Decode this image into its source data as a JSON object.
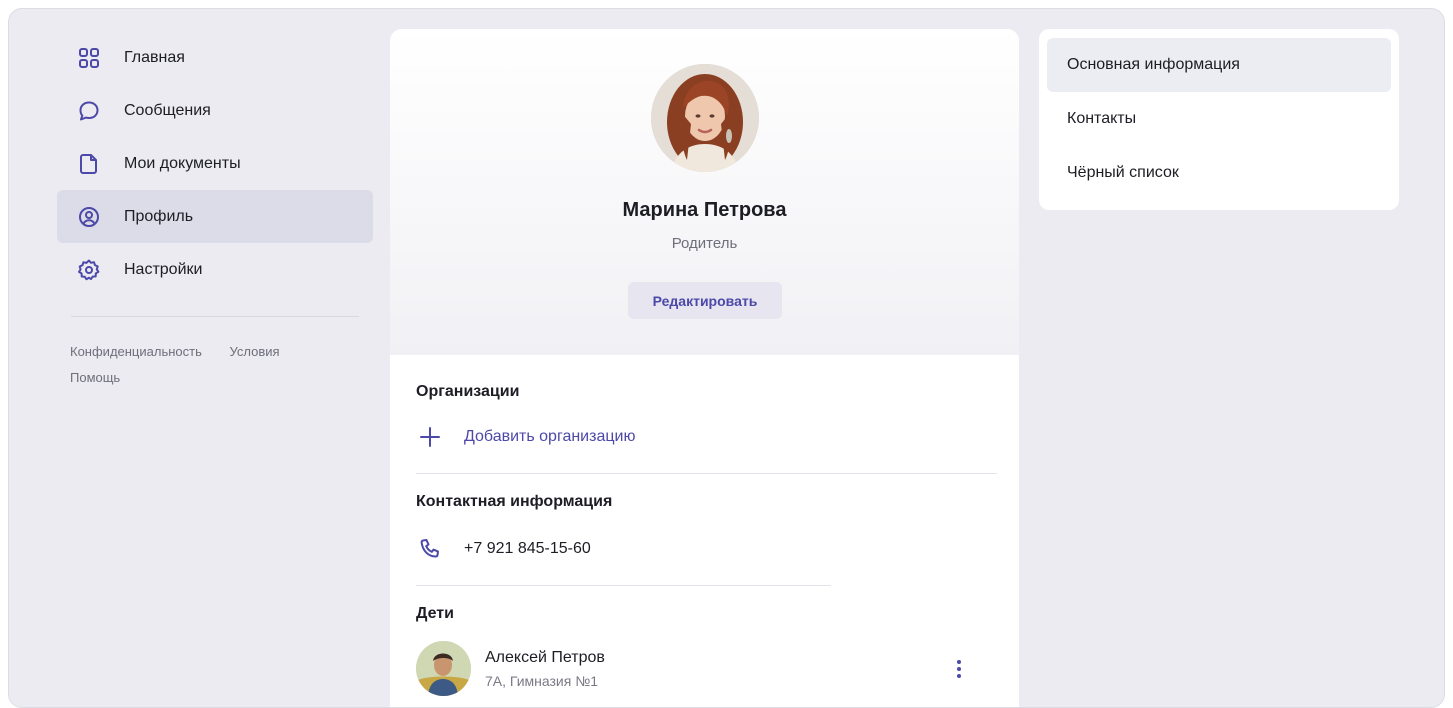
{
  "nav": {
    "items": [
      {
        "label": "Главная",
        "icon": "grid-icon"
      },
      {
        "label": "Сообщения",
        "icon": "chat-bubble-icon"
      },
      {
        "label": "Мои документы",
        "icon": "document-icon"
      },
      {
        "label": "Профиль",
        "icon": "user-circle-icon"
      },
      {
        "label": "Настройки",
        "icon": "gear-icon"
      }
    ],
    "active_index": 3,
    "footer": {
      "privacy": "Конфиденциальность",
      "terms": "Условия",
      "help": "Помощь"
    }
  },
  "profile": {
    "name": "Марина Петрова",
    "role": "Родитель",
    "edit_label": "Редактировать"
  },
  "organizations": {
    "title": "Организации",
    "add_label": "Добавить организацию"
  },
  "contacts": {
    "title": "Контактная информация",
    "phone": "+7 921 845-15-60"
  },
  "children": {
    "title": "Дети",
    "items": [
      {
        "name": "Алексей Петров",
        "class": "7А, Гимназия №1"
      }
    ]
  },
  "right_menu": {
    "items": [
      "Основная информация",
      "Контакты",
      "Чёрный список"
    ],
    "active_index": 0
  },
  "colors": {
    "accent": "#4d49a8",
    "background": "#ebebf1",
    "active": "#dcdbe8"
  }
}
